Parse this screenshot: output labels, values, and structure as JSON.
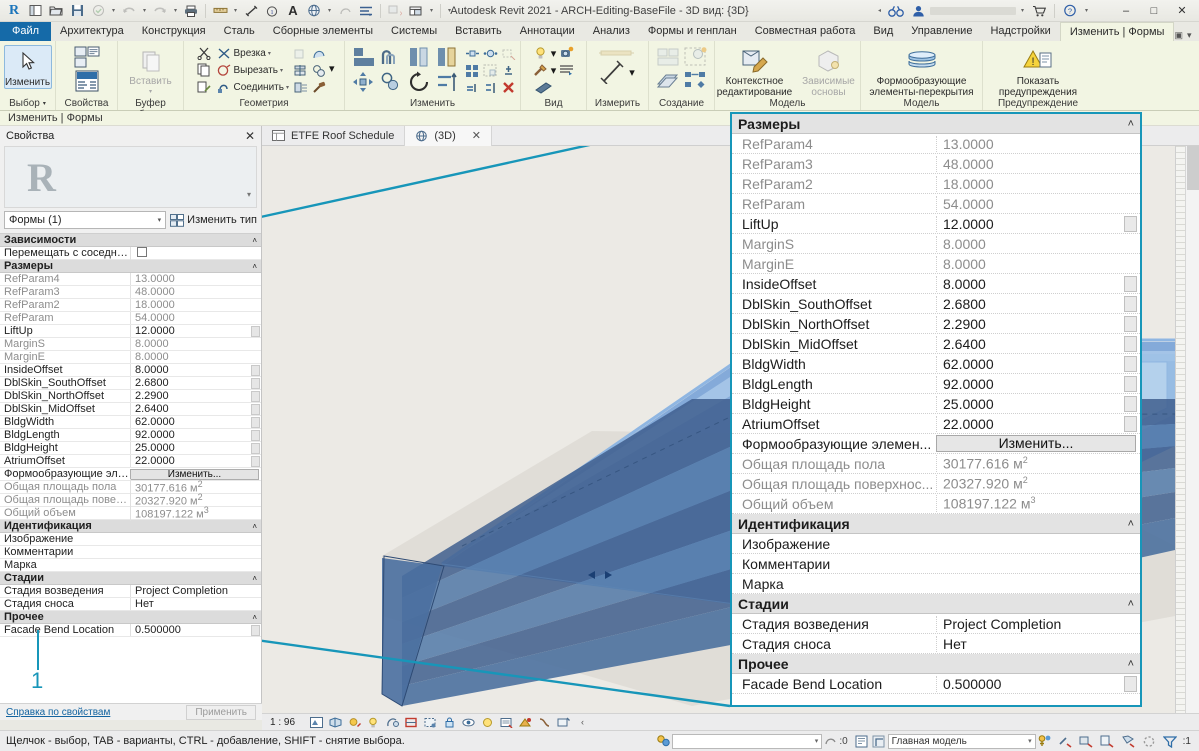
{
  "window": {
    "title": "Autodesk Revit 2021 - ARCH-Editing-BaseFile - 3D вид: {3D}",
    "minimize": "–",
    "maximize": "□",
    "close": "✕"
  },
  "quick_access": {
    "items": [
      {
        "name": "revit-logo-icon",
        "glyph": "R"
      },
      {
        "name": "new-project-icon",
        "glyph": "▣"
      },
      {
        "name": "open-icon",
        "glyph": "▷"
      },
      {
        "name": "save-icon",
        "glyph": "💾"
      },
      {
        "name": "save-cloud-icon",
        "glyph": "○"
      },
      {
        "name": "undo-icon",
        "glyph": "↶"
      },
      {
        "name": "redo-icon",
        "glyph": "↷"
      },
      {
        "name": "print-icon",
        "glyph": "⎙"
      },
      {
        "name": "measure-icon",
        "glyph": "▬"
      },
      {
        "name": "aligned-dimension-icon",
        "glyph": "↗"
      },
      {
        "name": "tag-icon",
        "glyph": "◎"
      },
      {
        "name": "text-icon",
        "glyph": "A"
      },
      {
        "name": "default-3d-view-icon",
        "glyph": "◔"
      },
      {
        "name": "section-icon",
        "glyph": "⬠"
      },
      {
        "name": "thin-lines-icon",
        "glyph": "≡"
      },
      {
        "name": "close-hidden-windows-icon",
        "glyph": "▧"
      },
      {
        "name": "switch-windows-icon",
        "glyph": "◫"
      },
      {
        "name": "customize-qat-icon",
        "glyph": "▼"
      }
    ]
  },
  "ribbon": {
    "tabs": [
      {
        "label": "Файл",
        "state": "file"
      },
      {
        "label": "Архитектура",
        "state": "normal"
      },
      {
        "label": "Конструкция",
        "state": "normal"
      },
      {
        "label": "Сталь",
        "state": "normal"
      },
      {
        "label": "Сборные элементы",
        "state": "normal"
      },
      {
        "label": "Системы",
        "state": "normal"
      },
      {
        "label": "Вставить",
        "state": "normal"
      },
      {
        "label": "Аннотации",
        "state": "normal"
      },
      {
        "label": "Анализ",
        "state": "normal"
      },
      {
        "label": "Формы и генплан",
        "state": "normal"
      },
      {
        "label": "Совместная работа",
        "state": "normal"
      },
      {
        "label": "Вид",
        "state": "normal"
      },
      {
        "label": "Управление",
        "state": "normal"
      },
      {
        "label": "Надстройки",
        "state": "normal"
      },
      {
        "label": "Изменить | Формы",
        "state": "active"
      }
    ],
    "context_label": "Изменить | Формы",
    "panels": {
      "select": {
        "title": "Выбор",
        "button": "Изменить"
      },
      "properties": {
        "title": "Свойства"
      },
      "clipboard": {
        "title": "Буфер обмена",
        "paste": "Вставить"
      },
      "geometry": {
        "title": "Геометрия",
        "items": [
          "Врезка",
          "Вырезать",
          "Соединить"
        ]
      },
      "modify": {
        "title": "Изменить"
      },
      "view": {
        "title": "Вид"
      },
      "measure": {
        "title": "Измерить"
      },
      "create": {
        "title": "Создание"
      },
      "model1": {
        "title": "Модель",
        "button": "Контекстное редактирование"
      },
      "model1b": {
        "button": "Зависимые основы"
      },
      "model2": {
        "title": "Модель",
        "button": "Формообразующие элементы-перекрытия"
      },
      "warning": {
        "title": "Предупреждение",
        "button": "Показать предупреждения"
      }
    }
  },
  "view_tabs": [
    {
      "label": "ETFE Roof Schedule",
      "icon": "schedule-icon",
      "active": false
    },
    {
      "label": "(3D)",
      "icon": "3d-view-icon",
      "active": true,
      "close": "✕"
    }
  ],
  "properties_palette": {
    "header": "Свойства",
    "close": "✕",
    "type_selector": "Формы (1)",
    "edit_type": "Изменить тип",
    "help_link": "Справка по свойствам",
    "apply_button": "Применить",
    "callout_number": "1",
    "groups": [
      {
        "name": "Зависимости",
        "rows": [
          {
            "key": "Перемещать с соседними э...",
            "value": "",
            "kind": "checkbox",
            "readonly": false
          }
        ]
      },
      {
        "name": "Размеры",
        "rows": [
          {
            "key": "RefParam4",
            "value": "13.0000",
            "readonly": true
          },
          {
            "key": "RefParam3",
            "value": "48.0000",
            "readonly": true
          },
          {
            "key": "RefParam2",
            "value": "18.0000",
            "readonly": true
          },
          {
            "key": "RefParam",
            "value": "54.0000",
            "readonly": true
          },
          {
            "key": "LiftUp",
            "value": "12.0000",
            "readonly": false,
            "grip": true
          },
          {
            "key": "MarginS",
            "value": "8.0000",
            "readonly": true
          },
          {
            "key": "MarginE",
            "value": "8.0000",
            "readonly": true
          },
          {
            "key": "InsideOffset",
            "value": "8.0000",
            "readonly": false,
            "grip": true
          },
          {
            "key": "DblSkin_SouthOffset",
            "value": "2.6800",
            "readonly": false,
            "grip": true
          },
          {
            "key": "DblSkin_NorthOffset",
            "value": "2.2900",
            "readonly": false,
            "grip": true
          },
          {
            "key": "DblSkin_MidOffset",
            "value": "2.6400",
            "readonly": false,
            "grip": true
          },
          {
            "key": "BldgWidth",
            "value": "62.0000",
            "readonly": false,
            "grip": true
          },
          {
            "key": "BldgLength",
            "value": "92.0000",
            "readonly": false,
            "grip": true
          },
          {
            "key": "BldgHeight",
            "value": "25.0000",
            "readonly": false,
            "grip": true
          },
          {
            "key": "AtriumOffset",
            "value": "22.0000",
            "readonly": false,
            "grip": true
          },
          {
            "key": "Формообразующие элемен...",
            "value": "Изменить...",
            "kind": "button",
            "readonly": false
          },
          {
            "key": "Общая площадь пола",
            "value": "30177.616 м²",
            "readonly": true
          },
          {
            "key": "Общая площадь поверхнос...",
            "value": "20327.920 м²",
            "readonly": true
          },
          {
            "key": "Общий объем",
            "value": "108197.122 м³",
            "readonly": true
          }
        ]
      },
      {
        "name": "Идентификация",
        "rows": [
          {
            "key": "Изображение",
            "value": "",
            "readonly": false
          },
          {
            "key": "Комментарии",
            "value": "",
            "readonly": false
          },
          {
            "key": "Марка",
            "value": "",
            "readonly": false
          }
        ]
      },
      {
        "name": "Стадии",
        "rows": [
          {
            "key": "Стадия возведения",
            "value": "Project Completion",
            "readonly": false
          },
          {
            "key": "Стадия сноса",
            "value": "Нет",
            "readonly": false
          }
        ]
      },
      {
        "name": "Прочее",
        "rows": [
          {
            "key": "Facade Bend Location",
            "value": "0.500000",
            "readonly": false,
            "grip": true
          }
        ]
      }
    ]
  },
  "magnified_panel": {
    "groups": [
      {
        "name": "Размеры",
        "rows": [
          {
            "key": "RefParam4",
            "value": "13.0000",
            "readonly": true
          },
          {
            "key": "RefParam3",
            "value": "48.0000",
            "readonly": true
          },
          {
            "key": "RefParam2",
            "value": "18.0000",
            "readonly": true
          },
          {
            "key": "RefParam",
            "value": "54.0000",
            "readonly": true
          },
          {
            "key": "LiftUp",
            "value": "12.0000",
            "readonly": false,
            "grip": true
          },
          {
            "key": "MarginS",
            "value": "8.0000",
            "readonly": true
          },
          {
            "key": "MarginE",
            "value": "8.0000",
            "readonly": true
          },
          {
            "key": "InsideOffset",
            "value": "8.0000",
            "readonly": false,
            "grip": true
          },
          {
            "key": "DblSkin_SouthOffset",
            "value": "2.6800",
            "readonly": false,
            "grip": true
          },
          {
            "key": "DblSkin_NorthOffset",
            "value": "2.2900",
            "readonly": false,
            "grip": true
          },
          {
            "key": "DblSkin_MidOffset",
            "value": "2.6400",
            "readonly": false,
            "grip": true
          },
          {
            "key": "BldgWidth",
            "value": "62.0000",
            "readonly": false,
            "grip": true
          },
          {
            "key": "BldgLength",
            "value": "92.0000",
            "readonly": false,
            "grip": true
          },
          {
            "key": "BldgHeight",
            "value": "25.0000",
            "readonly": false,
            "grip": true
          },
          {
            "key": "AtriumOffset",
            "value": "22.0000",
            "readonly": false,
            "grip": true
          },
          {
            "key": "Формообразующие элемен...",
            "value": "Изменить...",
            "kind": "button",
            "readonly": false
          },
          {
            "key": "Общая площадь пола",
            "value": "30177.616 м²",
            "readonly": true
          },
          {
            "key": "Общая площадь поверхнос...",
            "value": "20327.920 м²",
            "readonly": true
          },
          {
            "key": "Общий объем",
            "value": "108197.122 м³",
            "readonly": true
          }
        ]
      },
      {
        "name": "Идентификация",
        "rows": [
          {
            "key": "Изображение",
            "value": "",
            "readonly": false
          },
          {
            "key": "Комментарии",
            "value": "",
            "readonly": false
          },
          {
            "key": "Марка",
            "value": "",
            "readonly": false
          }
        ]
      },
      {
        "name": "Стадии",
        "rows": [
          {
            "key": "Стадия возведения",
            "value": "Project Completion",
            "readonly": false
          },
          {
            "key": "Стадия сноса",
            "value": "Нет",
            "readonly": false
          }
        ]
      },
      {
        "name": "Прочее",
        "rows": [
          {
            "key": "Facade Bend Location",
            "value": "0.500000",
            "readonly": false,
            "grip": true
          }
        ]
      }
    ]
  },
  "view_control_bar": {
    "scale": "1 : 96",
    "icons": [
      "detail-level-icon",
      "visual-style-icon",
      "sun-path-icon",
      "shadows-icon",
      "rendering-dialog-icon",
      "crop-view-icon",
      "show-crop-region-icon",
      "lock-3d-view-icon",
      "temporary-hide-isolate-icon",
      "reveal-hidden-icon",
      "temporary-view-properties-icon",
      "analytical-model-icon",
      "constraints-icon",
      "worksharing-display-icon",
      "expand-icon"
    ]
  },
  "status_bar": {
    "hint": "Щелчок - выбор, TAB - варианты, CTRL - добавление, SHIFT - снятие выбора.",
    "filter_value": "",
    "filter_placeholder": "",
    "selection_count": ":0",
    "design_option": "Главная модель",
    "filter_badge": ":1"
  },
  "colors": {
    "accent_callout": "#1796b9",
    "file_tab": "#156aa8",
    "ribbon_bg": "#f2f5e3",
    "model_blue": "#6f9fd8"
  }
}
